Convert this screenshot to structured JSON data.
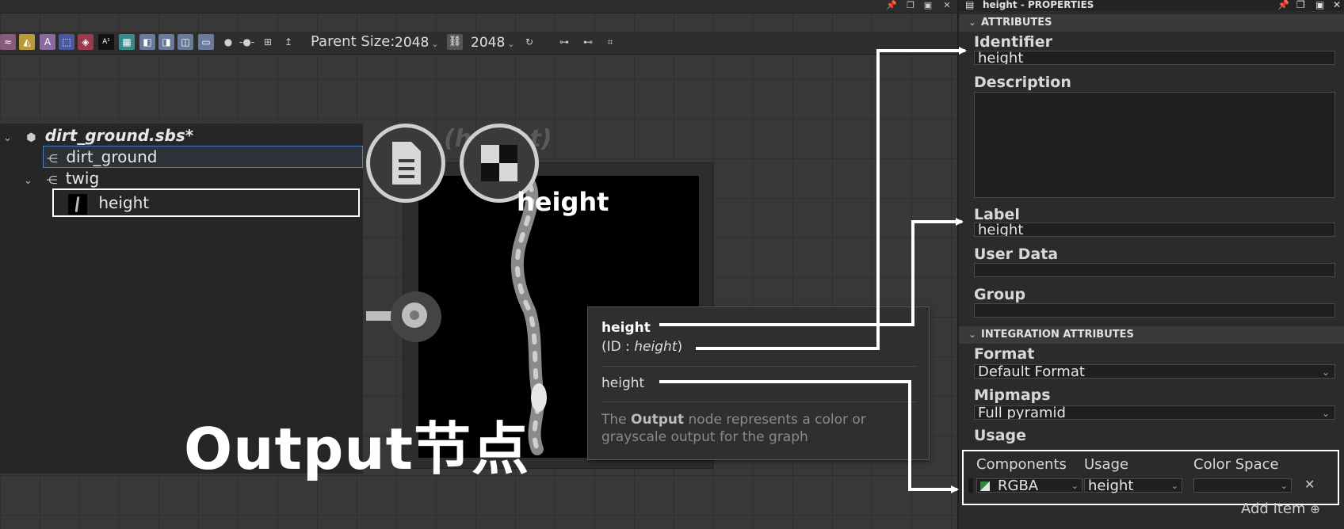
{
  "toolbar": {
    "parent_size_label": "Parent Size:",
    "parent_size_w": "2048",
    "parent_size_h": "2048",
    "icons": [
      "warp-icon",
      "sharpen-icon",
      "text-icon",
      "transform-icon",
      "fill-icon",
      "fx-map-icon",
      "pixel-processor-icon",
      "input-node-icon",
      "output-node-icon",
      "value-node-icon",
      "frame-node-icon"
    ]
  },
  "tree": {
    "root": "dirt_ground.sbs*",
    "graph1": "dirt_ground",
    "graph2": "twig",
    "output": "height"
  },
  "node": {
    "title": "height",
    "ghost_title": "(height)"
  },
  "tooltip": {
    "name": "height",
    "id_prefix": "(ID : ",
    "id_value": "height",
    "id_suffix": ")",
    "label": "height",
    "desc_pre": "The ",
    "desc_bold": "Output",
    "desc_post": " node represents a color or grayscale output for the graph"
  },
  "caption": "Output节点",
  "properties": {
    "title": "height - PROPERTIES",
    "section_attributes": "ATTRIBUTES",
    "identifier_label": "Identifier",
    "identifier_value": "height",
    "description_label": "Description",
    "label_label": "Label",
    "label_value": "height",
    "userdata_label": "User Data",
    "group_label": "Group",
    "section_integration": "INTEGRATION ATTRIBUTES",
    "format_label": "Format",
    "format_value": "Default Format",
    "mipmaps_label": "Mipmaps",
    "mipmaps_value": "Full pyramid",
    "usage_label": "Usage",
    "col_components": "Components",
    "col_usage": "Usage",
    "col_colorspace": "Color Space",
    "components_value": "RGBA",
    "usage_value": "height",
    "add_item": "Add Item"
  },
  "colors": {
    "accent": "#4a7fc0",
    "annotation": "#ffffff"
  }
}
